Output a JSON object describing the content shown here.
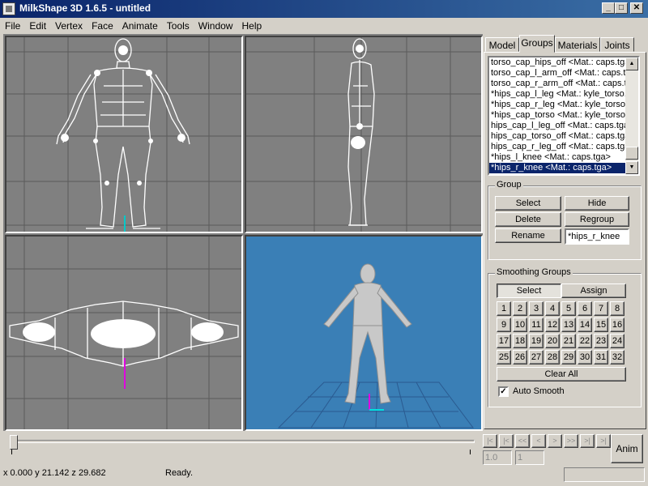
{
  "window": {
    "title": "MilkShape 3D 1.6.5 - untitled",
    "minimize": "_",
    "maximize": "□",
    "close": "✕"
  },
  "menu": [
    "File",
    "Edit",
    "Vertex",
    "Face",
    "Animate",
    "Tools",
    "Window",
    "Help"
  ],
  "tabs": [
    "Model",
    "Groups",
    "Materials",
    "Joints"
  ],
  "active_tab": "Groups",
  "groups_list": [
    "torso_cap_hips_off <Mat.: caps.tga>",
    "torso_cap_l_arm_off <Mat.: caps.tga>",
    "torso_cap_r_arm_off <Mat.: caps.tga>",
    "*hips_cap_l_leg <Mat.: kyle_torso.tga>",
    "*hips_cap_r_leg <Mat.: kyle_torso.tga>",
    "*hips_cap_torso <Mat.: kyle_torso.tga>",
    "hips_cap_l_leg_off <Mat.: caps.tga>",
    "hips_cap_torso_off <Mat.: caps.tga>",
    "hips_cap_r_leg_off <Mat.: caps.tga>",
    "*hips_l_knee <Mat.: caps.tga>",
    "*hips_r_knee <Mat.: caps.tga>"
  ],
  "selected_group": "*hips_r_knee <Mat.: caps.tga>",
  "group_box": {
    "label": "Group",
    "select": "Select",
    "hide": "Hide",
    "delete": "Delete",
    "regroup": "Regroup",
    "rename": "Rename",
    "name_value": "*hips_r_knee"
  },
  "smoothing": {
    "label": "Smoothing Groups",
    "select": "Select",
    "assign": "Assign",
    "numbers": [
      "1",
      "2",
      "3",
      "4",
      "5",
      "6",
      "7",
      "8",
      "9",
      "10",
      "11",
      "12",
      "13",
      "14",
      "15",
      "16",
      "17",
      "18",
      "19",
      "20",
      "21",
      "22",
      "23",
      "24",
      "25",
      "26",
      "27",
      "28",
      "29",
      "30",
      "31",
      "32"
    ],
    "clear_all": "Clear All",
    "auto_smooth": "Auto Smooth",
    "auto_smooth_checked": true
  },
  "timeline": {
    "nav": [
      "|<",
      "|<",
      "<<",
      "<",
      ">",
      ">>",
      ">|",
      ">|"
    ],
    "frame": "1.0",
    "total": "1",
    "anim": "Anim"
  },
  "status": {
    "coords": "x 0.000 y 21.142 z 29.682",
    "message": "Ready."
  },
  "colors": {
    "viewport_bg": "#808080",
    "perspective_bg": "#3a7fb6",
    "selection": "#0a246a"
  },
  "icons": [
    "app-icon",
    "minimize-icon",
    "maximize-icon",
    "close-icon",
    "scroll-up-icon",
    "scroll-down-icon",
    "checkmark-icon"
  ]
}
